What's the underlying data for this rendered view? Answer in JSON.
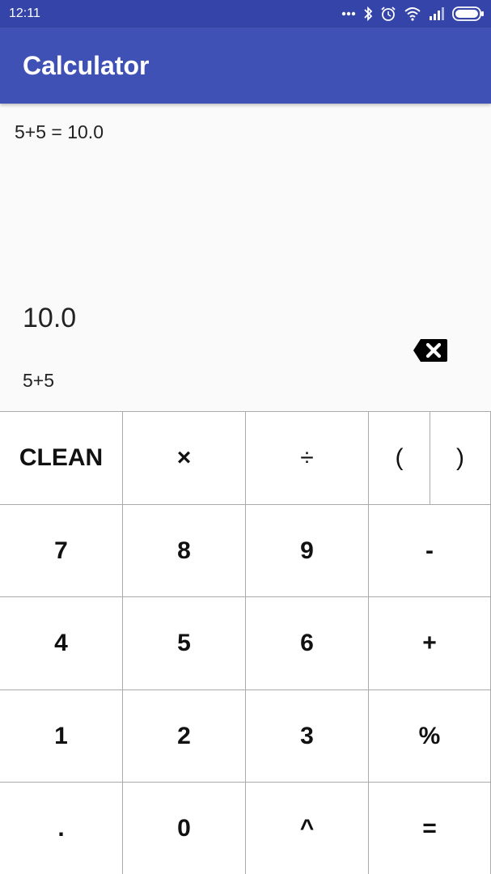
{
  "status_bar": {
    "time": "12:11",
    "icons": [
      "more-dots-icon",
      "bluetooth-icon",
      "alarm-icon",
      "wifi-icon",
      "signal-icon",
      "battery-icon"
    ]
  },
  "app_bar": {
    "title": "Calculator"
  },
  "display": {
    "history": "5+5 = 10.0",
    "result": "10.0",
    "expression": "5+5"
  },
  "keypad": {
    "row1": {
      "clean": "CLEAN",
      "multiply": "×",
      "divide": "÷",
      "open_paren": "(",
      "close_paren": ")"
    },
    "row2": {
      "k7": "7",
      "k8": "8",
      "k9": "9",
      "minus": "-"
    },
    "row3": {
      "k4": "4",
      "k5": "5",
      "k6": "6",
      "plus": "+"
    },
    "row4": {
      "k1": "1",
      "k2": "2",
      "k3": "3",
      "percent": "%"
    },
    "row5": {
      "dot": ".",
      "k0": "0",
      "power": "^",
      "equals": "="
    }
  },
  "colors": {
    "status_bar": "#3444a8",
    "app_bar": "#3f51b5",
    "background": "#fafafa",
    "grid_lines": "#aaaaaa"
  }
}
